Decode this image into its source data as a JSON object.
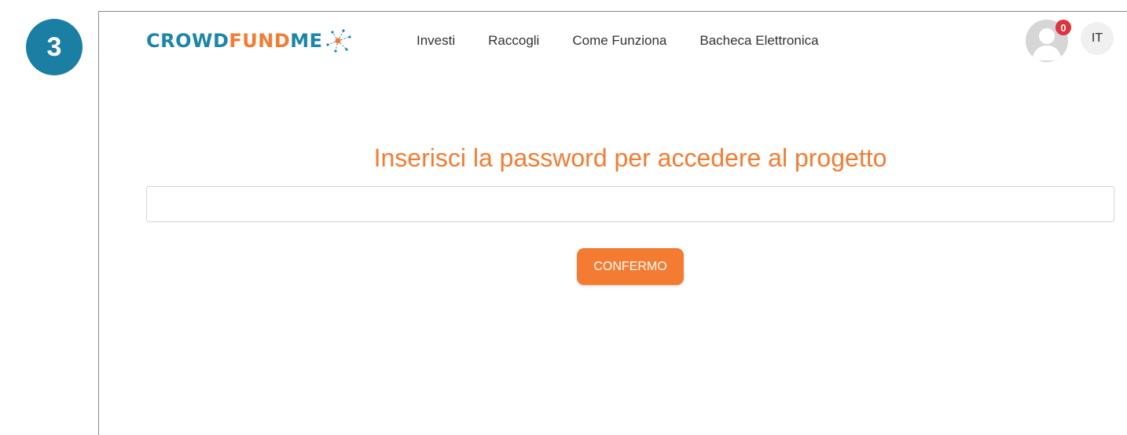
{
  "step": {
    "number": "3"
  },
  "header": {
    "logo": {
      "part1": "CROWD",
      "part2": "FUND",
      "part3": "ME"
    },
    "nav": [
      {
        "label": "Investi"
      },
      {
        "label": "Raccogli"
      },
      {
        "label": "Come Funziona"
      },
      {
        "label": "Bacheca Elettronica"
      }
    ],
    "notifications_count": "0",
    "language": "IT"
  },
  "main": {
    "title": "Inserisci la password per accedere al progetto",
    "password_value": "",
    "confirm_label": "CONFERMO"
  },
  "colors": {
    "brand_blue": "#1b86a8",
    "brand_orange": "#f47c32",
    "notification_red": "#e0323c"
  },
  "icons": {
    "logo_mark": "network-star-icon",
    "avatar": "user-avatar-icon"
  }
}
